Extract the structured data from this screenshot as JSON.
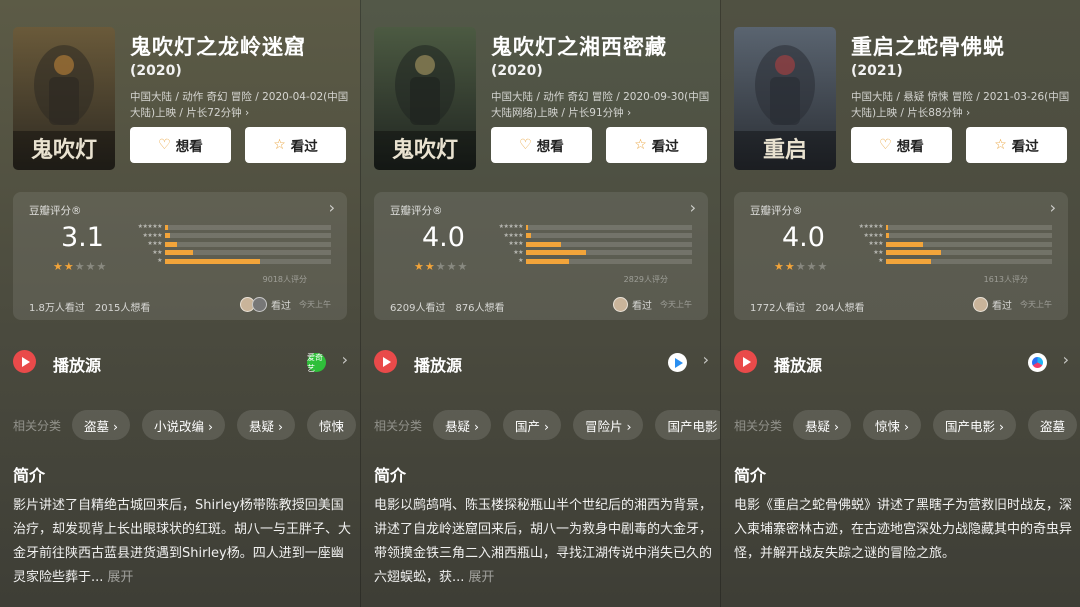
{
  "screens": [
    {
      "title": "鬼吹灯之龙岭迷窟",
      "year": "(2020)",
      "meta": "中国大陆 / 动作 奇幻 冒险 / 2020-04-02(中国大陆)上映 / 片长72分钟 ›",
      "poster_text": "鬼吹灯",
      "want_label": "想看",
      "seen_label": "看过",
      "rating_label": "豆瓣评分®",
      "score": "3.1",
      "stars_filled": 1.5,
      "distribution": [
        0.02,
        0.03,
        0.07,
        0.17,
        0.57
      ],
      "rating_count": "9018人评分",
      "watched": "1.8万人看过",
      "want": "2015人想看",
      "friend_action": "看过",
      "friend_time": "今天上午",
      "source_label": "播放源",
      "provider_icon": "iqiyi-icon",
      "provider_text": "爱奇艺",
      "categories_label": "相关分类",
      "categories": [
        "盗墓 ›",
        "小说改编 ›",
        "悬疑 ›",
        "惊悚"
      ],
      "intro_title": "简介",
      "intro": "影片讲述了自精绝古城回来后，Shirley杨带陈教授回美国治疗，却发现背上长出眼球状的红斑。胡八一与王胖子、大金牙前往陕西古蓝县进货遇到Shirley杨。四人进到一座幽灵家险些葬于...",
      "more_label": "展开"
    },
    {
      "title": "鬼吹灯之湘西密藏",
      "year": "(2020)",
      "meta": "中国大陆 / 动作 奇幻 冒险 / 2020-09-30(中国大陆网络)上映 / 片长91分钟 ›",
      "poster_text": "鬼吹灯",
      "want_label": "想看",
      "seen_label": "看过",
      "rating_label": "豆瓣评分®",
      "score": "4.0",
      "stars_filled": 2,
      "distribution": [
        0.01,
        0.03,
        0.21,
        0.36,
        0.26
      ],
      "rating_count": "2829人评分",
      "watched": "6209人看过",
      "want": "876人想看",
      "friend_action": "看过",
      "friend_time": "今天上午",
      "source_label": "播放源",
      "provider_icon": "tencent-video-icon",
      "provider_text": "",
      "categories_label": "相关分类",
      "categories": [
        "悬疑 ›",
        "国产 ›",
        "冒险片 ›",
        "国产电影"
      ],
      "intro_title": "简介",
      "intro": "电影以鹧鸪哨、陈玉楼探秘瓶山半个世纪后的湘西为背景，讲述了自龙岭迷窟回来后，胡八一为救身中剧毒的大金牙，带领摸金铁三角二入湘西瓶山，寻找江湖传说中消失已久的六翅蜈蚣，获...",
      "more_label": "展开"
    },
    {
      "title": "重启之蛇骨佛蜕",
      "year": "(2021)",
      "meta": "中国大陆 / 悬疑 惊悚 冒险 / 2021-03-26(中国大陆)上映 / 片长88分钟 ›",
      "poster_text": "重启",
      "want_label": "想看",
      "seen_label": "看过",
      "rating_label": "豆瓣评分®",
      "score": "4.0",
      "stars_filled": 2,
      "distribution": [
        0.01,
        0.02,
        0.22,
        0.33,
        0.27
      ],
      "rating_count": "1613人评分",
      "watched": "1772人看过",
      "want": "204人想看",
      "friend_action": "看过",
      "friend_time": "今天上午",
      "source_label": "播放源",
      "provider_icon": "youku-icon",
      "provider_text": "",
      "categories_label": "相关分类",
      "categories": [
        "悬疑 ›",
        "惊悚 ›",
        "国产电影 ›",
        "盗墓"
      ],
      "intro_title": "简介",
      "intro": "电影《重启之蛇骨佛蜕》讲述了黑瞎子为营救旧时战友，深入柬埔寨密林古迹，在古迹地宫深处力战隐藏其中的奇虫异怪，并解开战友失踪之谜的冒险之旅。",
      "more_label": ""
    }
  ],
  "colors": {
    "backgrounds": [
      "#5c5b46",
      "#535848",
      "#505142"
    ],
    "accent": "#f2a43a",
    "play": "#e94a4a"
  }
}
